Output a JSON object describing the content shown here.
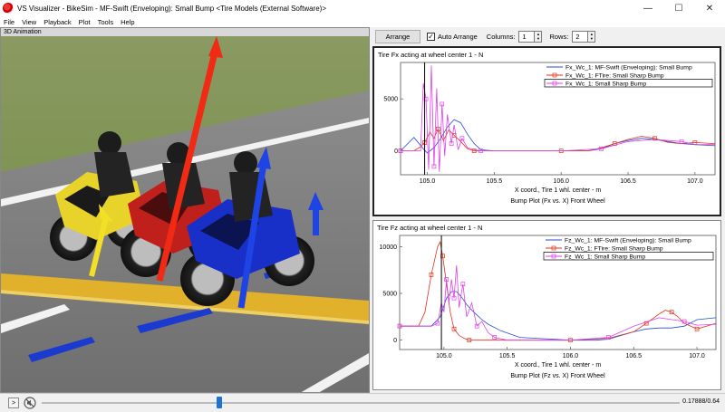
{
  "window": {
    "title": "VS Visualizer - BikeSim - MF-Swift (Enveloping): Small Bump <Tire Models (External Software)>",
    "controls": {
      "minimize": "—",
      "maximize": "☐",
      "close": "✕"
    }
  },
  "menu": [
    "File",
    "View",
    "Playback",
    "Plot",
    "Tools",
    "Help"
  ],
  "animation": {
    "label": "3D Animation"
  },
  "toolbar": {
    "arrange_label": "Arrange",
    "auto_arrange_label": "Auto Arrange",
    "auto_arrange_checked": "✓",
    "columns_label": "Columns:",
    "columns_value": "1",
    "rows_label": "Rows:",
    "rows_value": "2"
  },
  "colors": {
    "blue": "#1f4fd6",
    "red": "#e0321a",
    "magenta": "#e040e8",
    "cursor": "#000000"
  },
  "chart_data": [
    {
      "type": "line",
      "title": "Tire Fx acting at wheel center 1 - N",
      "xlabel": "X coord., Tire 1 whl. center - m",
      "caption": "Bump Plot (Fx vs. X) Front Wheel",
      "xlim": [
        104.8,
        107.15
      ],
      "ylim": [
        -2300,
        8500
      ],
      "xticks": [
        105.0,
        105.5,
        106.0,
        106.5,
        107.0
      ],
      "xtick_labels": [
        "105.0",
        "105.5",
        "106.0",
        "106.5",
        "107.0"
      ],
      "yticks": [
        0,
        5000
      ],
      "ytick_labels": [
        "0",
        "5000"
      ],
      "cursor_x": 104.98,
      "legend": [
        "Fx_Wc_1: MF-Swift (Enveloping): Small Bump",
        "Fx_Wc_1: FTire: Small Sharp Bump",
        "Fx_Wc_1: Small Sharp Bump"
      ],
      "series": [
        {
          "name": "Fx_Wc_1: MF-Swift (Enveloping): Small Bump",
          "color": "#1f4fd6",
          "marker": "none",
          "x": [
            104.8,
            104.9,
            104.97,
            105.0,
            105.05,
            105.1,
            105.15,
            105.2,
            105.25,
            105.3,
            105.35,
            105.4,
            105.5,
            105.6,
            106.0,
            106.2,
            106.3,
            106.4,
            106.5,
            106.6,
            106.7,
            106.8,
            106.9,
            107.0,
            107.15
          ],
          "y": [
            0,
            1300,
            200,
            -200,
            300,
            1200,
            2300,
            3000,
            2700,
            1600,
            700,
            100,
            0,
            0,
            0,
            0,
            200,
            700,
            1000,
            1200,
            1100,
            900,
            700,
            600,
            500
          ]
        },
        {
          "name": "Fx_Wc_1: FTire: Small Sharp Bump",
          "color": "#e0321a",
          "marker": "square",
          "x": [
            104.8,
            104.9,
            104.95,
            104.98,
            105.02,
            105.05,
            105.08,
            105.12,
            105.16,
            105.2,
            105.25,
            105.3,
            105.35,
            105.4,
            105.5,
            106.0,
            106.2,
            106.3,
            106.4,
            106.5,
            106.6,
            106.7,
            106.8,
            106.9,
            107.0,
            107.15
          ],
          "y": [
            0,
            0,
            400,
            800,
            1800,
            1200,
            2100,
            1000,
            2000,
            1500,
            900,
            200,
            0,
            0,
            0,
            0,
            0,
            300,
            700,
            1100,
            1400,
            1200,
            800,
            700,
            800,
            700
          ]
        },
        {
          "name": "Fx_Wc_1: Small Sharp Bump",
          "color": "#e040e8",
          "marker": "square",
          "x": [
            104.8,
            104.95,
            104.97,
            104.99,
            105.01,
            105.03,
            105.05,
            105.07,
            105.09,
            105.11,
            105.13,
            105.15,
            105.18,
            105.2,
            105.23,
            105.26,
            105.3,
            105.35,
            105.4,
            105.5,
            106.0,
            106.3,
            106.5,
            106.7,
            106.9,
            107.0,
            107.15
          ],
          "y": [
            0,
            0,
            6500,
            5000,
            -1800,
            8200,
            -1500,
            6000,
            -2000,
            4500,
            -500,
            3500,
            700,
            2500,
            100,
            1200,
            300,
            100,
            0,
            0,
            0,
            200,
            900,
            1100,
            900,
            600,
            600
          ]
        }
      ]
    },
    {
      "type": "line",
      "title": "Tire Fz acting at wheel center 1 - N",
      "xlabel": "X coord., Tire 1 whl. center - m",
      "caption": "Bump Plot (Fz vs. X) Front Wheel",
      "xlim": [
        104.65,
        107.15
      ],
      "ylim": [
        -1000,
        11200
      ],
      "xticks": [
        105.0,
        105.5,
        106.0,
        106.5,
        107.0
      ],
      "xtick_labels": [
        "105.0",
        "105.5",
        "106.0",
        "106.5",
        "107.0"
      ],
      "yticks": [
        0,
        5000,
        10000
      ],
      "ytick_labels": [
        "0",
        "5000",
        "10000"
      ],
      "cursor_x": 104.98,
      "legend": [
        "Fz_Wc_1: MF-Swift (Enveloping): Small Bump",
        "Fz_Wc_1: FTire: Small Sharp Bump",
        "Fz_Wc_1: Small Sharp Bump"
      ],
      "series": [
        {
          "name": "Fz_Wc_1: MF-Swift (Enveloping): Small Bump",
          "color": "#1f4fd6",
          "marker": "none",
          "x": [
            104.65,
            104.8,
            104.9,
            104.97,
            105.02,
            105.06,
            105.1,
            105.14,
            105.18,
            105.22,
            105.26,
            105.3,
            105.35,
            105.45,
            105.6,
            106.0,
            106.2,
            106.3,
            106.4,
            106.5,
            106.6,
            106.7,
            106.8,
            106.9,
            107.0,
            107.15
          ],
          "y": [
            1500,
            1500,
            1500,
            2500,
            4500,
            5200,
            5200,
            4600,
            3800,
            3200,
            2700,
            2200,
            1700,
            1000,
            300,
            0,
            0,
            100,
            500,
            900,
            1200,
            1300,
            1300,
            1500,
            2200,
            2400
          ]
        },
        {
          "name": "Fz_Wc_1: FTire: Small Sharp Bump",
          "color": "#e0321a",
          "marker": "square",
          "x": [
            104.65,
            104.8,
            104.85,
            104.9,
            104.95,
            104.97,
            104.99,
            105.02,
            105.05,
            105.08,
            105.12,
            105.16,
            105.2,
            105.3,
            105.5,
            106.0,
            106.3,
            106.5,
            106.6,
            106.7,
            106.75,
            106.8,
            106.85,
            106.9,
            107.0,
            107.15
          ],
          "y": [
            1500,
            1500,
            3000,
            7000,
            10000,
            10500,
            9000,
            6000,
            3000,
            1200,
            500,
            200,
            0,
            0,
            0,
            0,
            200,
            900,
            1800,
            2800,
            3200,
            3000,
            2500,
            1800,
            1200,
            1800
          ]
        },
        {
          "name": "Fz_Wc_1: Small Sharp Bump",
          "color": "#e040e8",
          "marker": "square",
          "x": [
            104.65,
            104.8,
            104.9,
            104.95,
            104.98,
            105.0,
            105.02,
            105.04,
            105.06,
            105.08,
            105.1,
            105.12,
            105.15,
            105.18,
            105.22,
            105.26,
            105.3,
            105.35,
            105.4,
            105.5,
            106.0,
            106.3,
            106.5,
            106.7,
            106.9,
            107.0,
            107.15
          ],
          "y": [
            1500,
            1500,
            1500,
            1800,
            4000,
            3000,
            6500,
            4000,
            6500,
            4500,
            8000,
            3500,
            6000,
            2500,
            4000,
            1500,
            2000,
            800,
            300,
            0,
            0,
            300,
            1500,
            2400,
            2000,
            1600,
            1700
          ]
        }
      ]
    }
  ],
  "playback": {
    "play_icon": ">",
    "progress_fraction": 0.279,
    "time_readout": "0.17888/0.64"
  }
}
